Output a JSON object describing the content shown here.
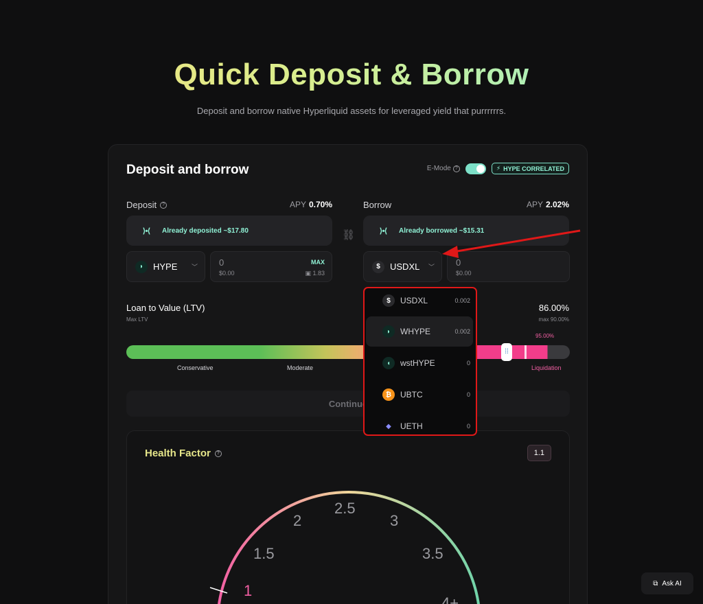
{
  "hero": {
    "title": "Quick Deposit & Borrow",
    "subtitle": "Deposit and borrow native Hyperliquid assets for leveraged yield that purrrrrrs."
  },
  "card": {
    "title": "Deposit and borrow",
    "emode_label": "E-Mode",
    "emode_on": true,
    "emode_badge": "HYPE CORRELATED"
  },
  "deposit": {
    "label": "Deposit",
    "apy_label": "APY",
    "apy": "0.70%",
    "already": "Already deposited ~$17.80",
    "asset": "HYPE",
    "amount": "0",
    "amount_usd": "$0.00",
    "max_label": "MAX",
    "balance": "1.83"
  },
  "borrow": {
    "label": "Borrow",
    "apy_label": "APY",
    "apy": "2.02%",
    "already": "Already borrowed ~$15.31",
    "asset": "USDXL",
    "amount": "0",
    "amount_usd": "$0.00"
  },
  "ltv": {
    "label": "Loan to Value (LTV)",
    "sub": "Max LTV",
    "value": "86.00%",
    "max": "max 90.00%",
    "liquidation_pct": "95.00%",
    "fill_fraction": 0.86,
    "labels": [
      "Conservative",
      "Moderate",
      "Liquidation"
    ]
  },
  "continue_label": "Continue",
  "health": {
    "title": "Health Factor",
    "value": "1.1",
    "ticks": [
      "1",
      "1.5",
      "2",
      "2.5",
      "3",
      "3.5",
      "4+"
    ]
  },
  "dropdown": {
    "items": [
      {
        "name": "USDXL",
        "balance": "0.002",
        "icon": "dollar-icon"
      },
      {
        "name": "WHYPE",
        "balance": "0.002",
        "icon": "hype-icon"
      },
      {
        "name": "wstHYPE",
        "balance": "0",
        "icon": "wsthype-icon"
      },
      {
        "name": "UBTC",
        "balance": "0",
        "icon": "bitcoin-icon"
      },
      {
        "name": "UETH",
        "balance": "0",
        "icon": "ethereum-icon"
      }
    ]
  },
  "ask_ai": "Ask AI",
  "colors": {
    "accent": "#8ff0d4",
    "liquidation": "#f23d8a",
    "highlight_box": "#e01818"
  }
}
